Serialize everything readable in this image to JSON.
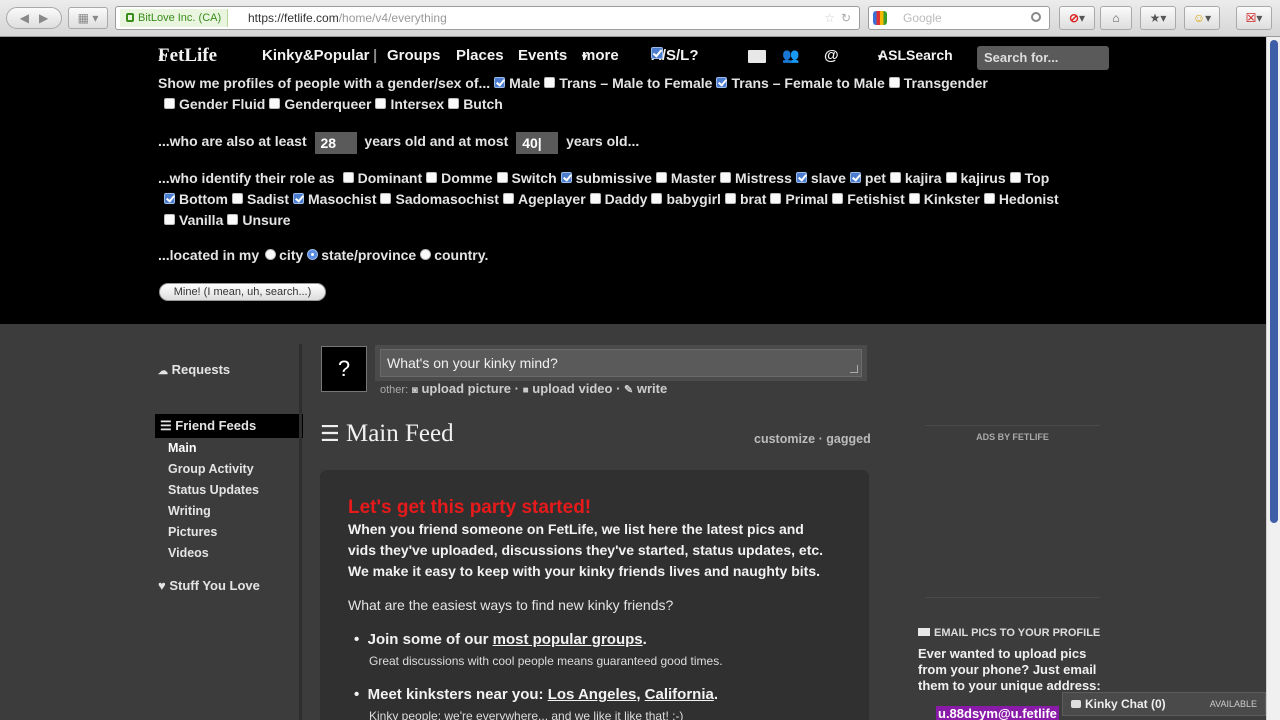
{
  "browser": {
    "cert_label": "BitLove Inc. (CA)",
    "url_host": "https://fetlife.com",
    "url_path": "/home/v4/everything",
    "search_placeholder": "Google"
  },
  "nav": {
    "logo": "FetLife",
    "kinky_popular": "Kinky&Popular",
    "groups": "Groups",
    "places": "Places",
    "events": "Events",
    "more": "more",
    "asl": "A/S/L?",
    "at": "@",
    "asl_search": "ASLSearch",
    "search_placeholder": "Search for..."
  },
  "asl": {
    "gender_prompt": "Show me profiles of people with a gender/sex of...",
    "genders": [
      {
        "label": "Male",
        "checked": true
      },
      {
        "label": "Trans – Male to Female",
        "checked": false
      },
      {
        "label": "Trans – Female to Male",
        "checked": true
      },
      {
        "label": "Transgender",
        "checked": false
      },
      {
        "label": "Gender Fluid",
        "checked": false
      },
      {
        "label": "Genderqueer",
        "checked": false
      },
      {
        "label": "Intersex",
        "checked": false
      },
      {
        "label": "Butch",
        "checked": false
      }
    ],
    "age_prefix": "...who are also at least",
    "age_min": "28",
    "age_mid": "years old and at most",
    "age_max": "40|",
    "age_suffix": "years old...",
    "role_prompt": "...who identify their role as",
    "roles": [
      {
        "label": "Dominant",
        "checked": false
      },
      {
        "label": "Domme",
        "checked": false
      },
      {
        "label": "Switch",
        "checked": false
      },
      {
        "label": "submissive",
        "checked": true
      },
      {
        "label": "Master",
        "checked": false
      },
      {
        "label": "Mistress",
        "checked": false
      },
      {
        "label": "slave",
        "checked": true
      },
      {
        "label": "pet",
        "checked": true
      },
      {
        "label": "kajira",
        "checked": false
      },
      {
        "label": "kajirus",
        "checked": false
      },
      {
        "label": "Top",
        "checked": false
      },
      {
        "label": "Bottom",
        "checked": true
      },
      {
        "label": "Sadist",
        "checked": false
      },
      {
        "label": "Masochist",
        "checked": true
      },
      {
        "label": "Sadomasochist",
        "checked": false
      },
      {
        "label": "Ageplayer",
        "checked": false
      },
      {
        "label": "Daddy",
        "checked": false
      },
      {
        "label": "babygirl",
        "checked": false
      },
      {
        "label": "brat",
        "checked": false
      },
      {
        "label": "Primal",
        "checked": false
      },
      {
        "label": "Fetishist",
        "checked": false
      },
      {
        "label": "Kinkster",
        "checked": false
      },
      {
        "label": "Hedonist",
        "checked": false
      },
      {
        "label": "Vanilla",
        "checked": false
      },
      {
        "label": "Unsure",
        "checked": false
      }
    ],
    "location_prompt": "...located in my",
    "locations": [
      {
        "label": "city",
        "selected": false
      },
      {
        "label": "state/province",
        "selected": true
      },
      {
        "label": "country.",
        "selected": false
      }
    ],
    "submit_label": "Mine! (I mean, uh, search...)"
  },
  "sidebar": {
    "requests": "Requests",
    "friend_feeds": "Friend Feeds",
    "items": [
      "Main",
      "Group Activity",
      "Status Updates",
      "Writing",
      "Pictures",
      "Videos"
    ],
    "stuff_you_love": "Stuff You Love"
  },
  "composer": {
    "avatar_glyph": "?",
    "placeholder": "What's on your kinky mind?",
    "other_label": "other:",
    "upload_picture": "upload picture",
    "upload_video": "upload video",
    "write": "write",
    "sep": "·"
  },
  "feed": {
    "title": "Main Feed",
    "customize": "customize",
    "dot": "·",
    "gagged": "gagged",
    "card_title": "Let's get this party started!",
    "card_lines": [
      "When you friend someone on FetLife, we list here the latest pics and",
      "vids they've uploaded, discussions they've started, status updates, etc.",
      "We make it easy to keep with your kinky friends lives and naughty bits."
    ],
    "question": "What are the easiest ways to find new kinky friends?",
    "bullet1_prefix": "Join some of our",
    "bullet1_link": "most popular groups",
    "bullet1_suffix": ".",
    "bullet1_sub": "Great discussions with cool people means guaranteed good times.",
    "bullet2_prefix": "Meet kinksters near you:",
    "bullet2_city": "Los Angeles",
    "bullet2_comma": ",",
    "bullet2_state": "California",
    "bullet2_suffix": ".",
    "bullet2_sub": "Kinky people: we're everywhere... and we like it like that! :-)"
  },
  "right": {
    "ads_label": "ADS BY FETLIFE",
    "email_title": "EMAIL PICS TO YOUR PROFILE",
    "email_body": "Ever wanted to upload pics from your phone? Just email them to your unique address:",
    "email_addr": "u.88dsym@u.fetlife"
  },
  "chat": {
    "label": "Kinky Chat (0)",
    "status": "AVAILABLE"
  },
  "colors": {
    "accent_red": "#e61a1a",
    "checkbox_blue": "#4b7ccf",
    "email_highlight": "#8a1aa8"
  }
}
